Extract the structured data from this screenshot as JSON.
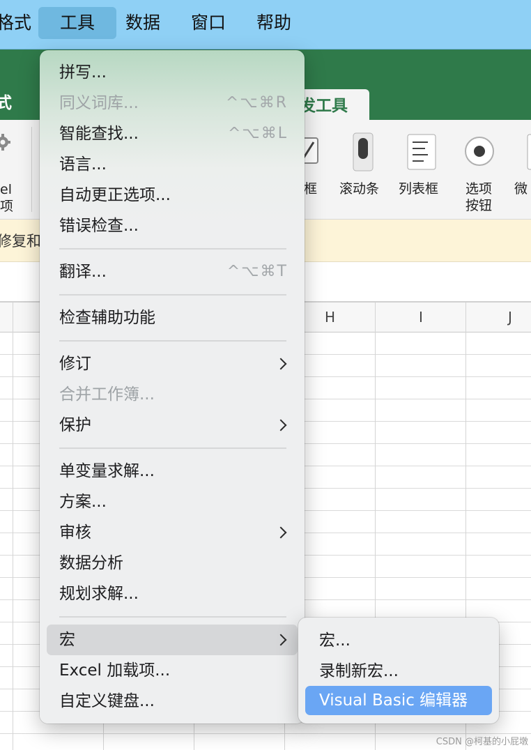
{
  "menubar": {
    "items": [
      {
        "label": "格式"
      },
      {
        "label": "工具"
      },
      {
        "label": "数据"
      },
      {
        "label": "窗口"
      },
      {
        "label": "帮助"
      }
    ]
  },
  "ribbon": {
    "partial_tab_left": "式",
    "active_tab": "发工具",
    "left_item_line1": "el",
    "left_item_line2": "项",
    "controls": [
      {
        "label": "框"
      },
      {
        "label": "滚动条"
      },
      {
        "label": "列表框"
      },
      {
        "label_line1": "选项",
        "label_line2": "按钮"
      },
      {
        "label": "微"
      }
    ]
  },
  "message_bar": {
    "text": "修复和改"
  },
  "grid": {
    "columns": [
      "H",
      "I",
      "J"
    ]
  },
  "tools_menu": {
    "items": [
      {
        "label": "拼写...",
        "shortcut": "",
        "disabled": false
      },
      {
        "label": "同义词库...",
        "shortcut": "^⌥⌘R",
        "disabled": true
      },
      {
        "label": "智能查找...",
        "shortcut": "^⌥⌘L",
        "disabled": false
      },
      {
        "label": "语言...",
        "shortcut": "",
        "disabled": false
      },
      {
        "label": "自动更正选项...",
        "shortcut": "",
        "disabled": false
      },
      {
        "label": "错误检查...",
        "shortcut": "",
        "disabled": false
      },
      {
        "label": "翻译...",
        "shortcut": "^⌥⌘T",
        "disabled": false
      },
      {
        "label": "检查辅助功能",
        "shortcut": "",
        "disabled": false
      },
      {
        "label": "修订",
        "submenu": true
      },
      {
        "label": "合并工作簿...",
        "disabled": true
      },
      {
        "label": "保护",
        "submenu": true
      },
      {
        "label": "单变量求解..."
      },
      {
        "label": "方案..."
      },
      {
        "label": "审核",
        "submenu": true
      },
      {
        "label": "数据分析"
      },
      {
        "label": "规划求解..."
      },
      {
        "label": "宏",
        "submenu": true,
        "highlighted": true
      },
      {
        "label": "Excel 加载项..."
      },
      {
        "label": "自定义键盘..."
      }
    ]
  },
  "macro_submenu": {
    "items": [
      {
        "label": "宏..."
      },
      {
        "label": "录制新宏..."
      },
      {
        "label": "Visual Basic 编辑器",
        "selected": true
      }
    ]
  },
  "watermark": "CSDN @柯基的小屁墩",
  "colors": {
    "menubar_bg": "#8fd0f5",
    "ribbon_green": "#2f7a4a",
    "selection_blue": "#6aa6f4",
    "message_bar_bg": "#fdf4d8"
  }
}
